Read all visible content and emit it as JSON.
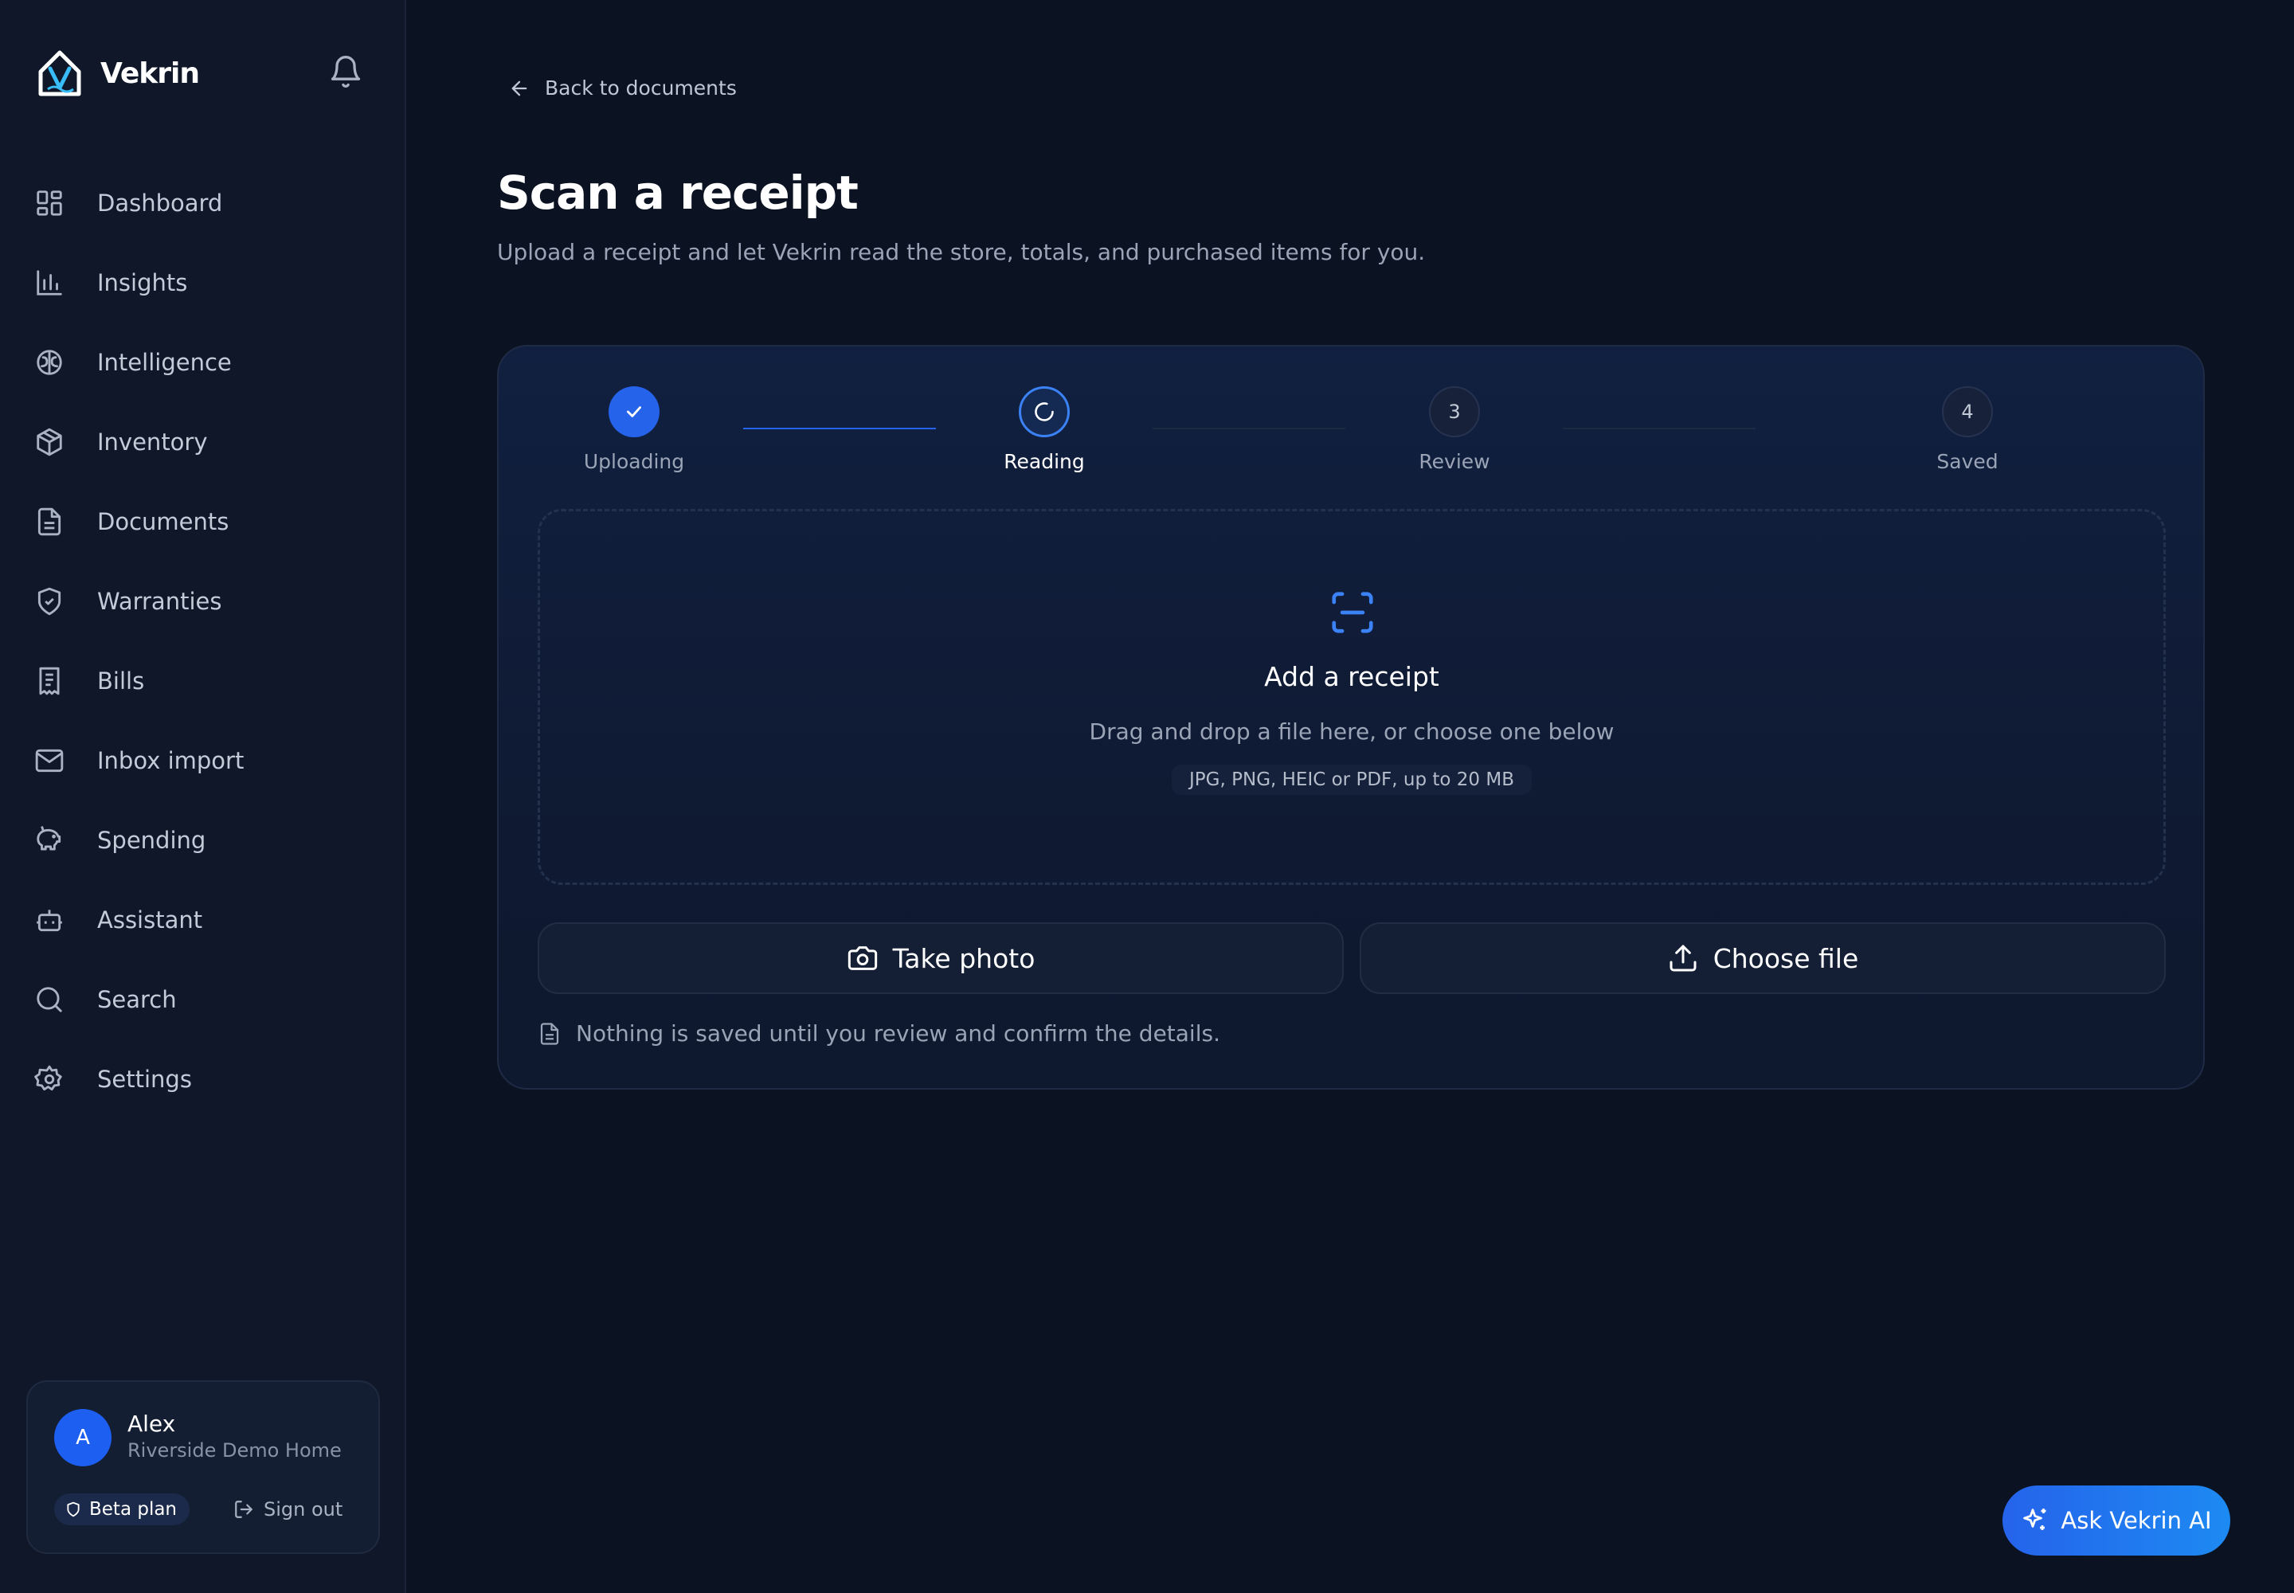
{
  "brand": {
    "name": "Vekrin"
  },
  "nav": [
    {
      "label": "Dashboard",
      "icon": "dashboard-icon"
    },
    {
      "label": "Insights",
      "icon": "bar-chart-icon"
    },
    {
      "label": "Intelligence",
      "icon": "brain-icon"
    },
    {
      "label": "Inventory",
      "icon": "package-icon"
    },
    {
      "label": "Documents",
      "icon": "document-icon"
    },
    {
      "label": "Warranties",
      "icon": "shield-check-icon"
    },
    {
      "label": "Bills",
      "icon": "receipt-icon"
    },
    {
      "label": "Inbox import",
      "icon": "mail-icon"
    },
    {
      "label": "Spending",
      "icon": "piggy-bank-icon"
    },
    {
      "label": "Assistant",
      "icon": "bot-icon"
    },
    {
      "label": "Search",
      "icon": "search-icon"
    },
    {
      "label": "Settings",
      "icon": "gear-icon"
    }
  ],
  "user": {
    "initial": "A",
    "name": "Alex",
    "home": "Riverside Demo Home",
    "plan": "Beta plan",
    "sign_out": "Sign out"
  },
  "main": {
    "back_link": "Back to documents",
    "title": "Scan a receipt",
    "subtitle": "Upload a receipt and let Vekrin read the store, totals, and purchased items for you."
  },
  "steps": [
    {
      "label": "Uploading",
      "state": "done"
    },
    {
      "label": "Reading",
      "state": "active"
    },
    {
      "number": "3",
      "label": "Review",
      "state": "pending"
    },
    {
      "number": "4",
      "label": "Saved",
      "state": "pending"
    }
  ],
  "dropzone": {
    "title": "Add a receipt",
    "description": "Drag and drop a file here, or choose one below",
    "hint": "JPG, PNG, HEIC or PDF, up to 20 MB"
  },
  "actions": {
    "take_photo": "Take photo",
    "choose_file": "Choose file"
  },
  "note": "Nothing is saved until you review and confirm the details.",
  "assistant_button": "Ask Vekrin AI",
  "colors": {
    "background": "#0b1222",
    "sidebar": "#0f1729",
    "accent": "#2563eb",
    "text_muted": "#9aa4b6"
  }
}
